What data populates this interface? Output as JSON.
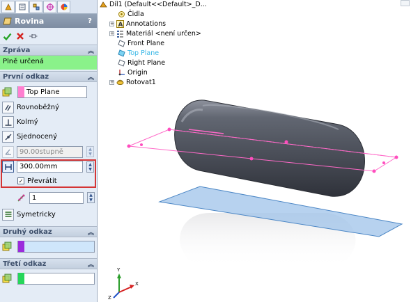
{
  "panel": {
    "title": "Rovina",
    "help": "?",
    "sections": {
      "message": {
        "header": "Zpráva",
        "text": "Plně určená"
      },
      "first_ref": {
        "header": "První odkaz",
        "ref_value": "Top Plane",
        "options": [
          "Rovnoběžný",
          "Kolmý",
          "Sjednocený"
        ],
        "angle_value": "90.00stupně",
        "distance_value": "300.00mm",
        "flip_label": "Převrátit",
        "flip_checked": true,
        "count_value": "1",
        "symmetric_label": "Symetricky"
      },
      "second_ref": {
        "header": "Druhý odkaz"
      },
      "third_ref": {
        "header": "Třetí odkaz"
      }
    },
    "colors": {
      "first": "#ff7fd0",
      "second": "#9b2bdc",
      "third": "#26d65a"
    }
  },
  "tree": {
    "root": "Díl1  (Default<<Default>_D...",
    "items": [
      {
        "label": "Čidla",
        "icon": "sensors-icon",
        "expandable": false
      },
      {
        "label": "Annotations",
        "icon": "annotations-icon",
        "expandable": true
      },
      {
        "label": "Materiál <není určen>",
        "icon": "material-icon",
        "expandable": true
      },
      {
        "label": "Front Plane",
        "icon": "plane-icon",
        "expandable": false
      },
      {
        "label": "Top Plane",
        "icon": "plane-icon",
        "expandable": false,
        "highlight": true
      },
      {
        "label": "Right Plane",
        "icon": "plane-icon",
        "expandable": false
      },
      {
        "label": "Origin",
        "icon": "origin-icon",
        "expandable": false
      },
      {
        "label": "Rotovat1",
        "icon": "revolve-icon",
        "expandable": true
      }
    ]
  },
  "triad": {
    "x": "X",
    "y": "Y",
    "z": "Z"
  }
}
